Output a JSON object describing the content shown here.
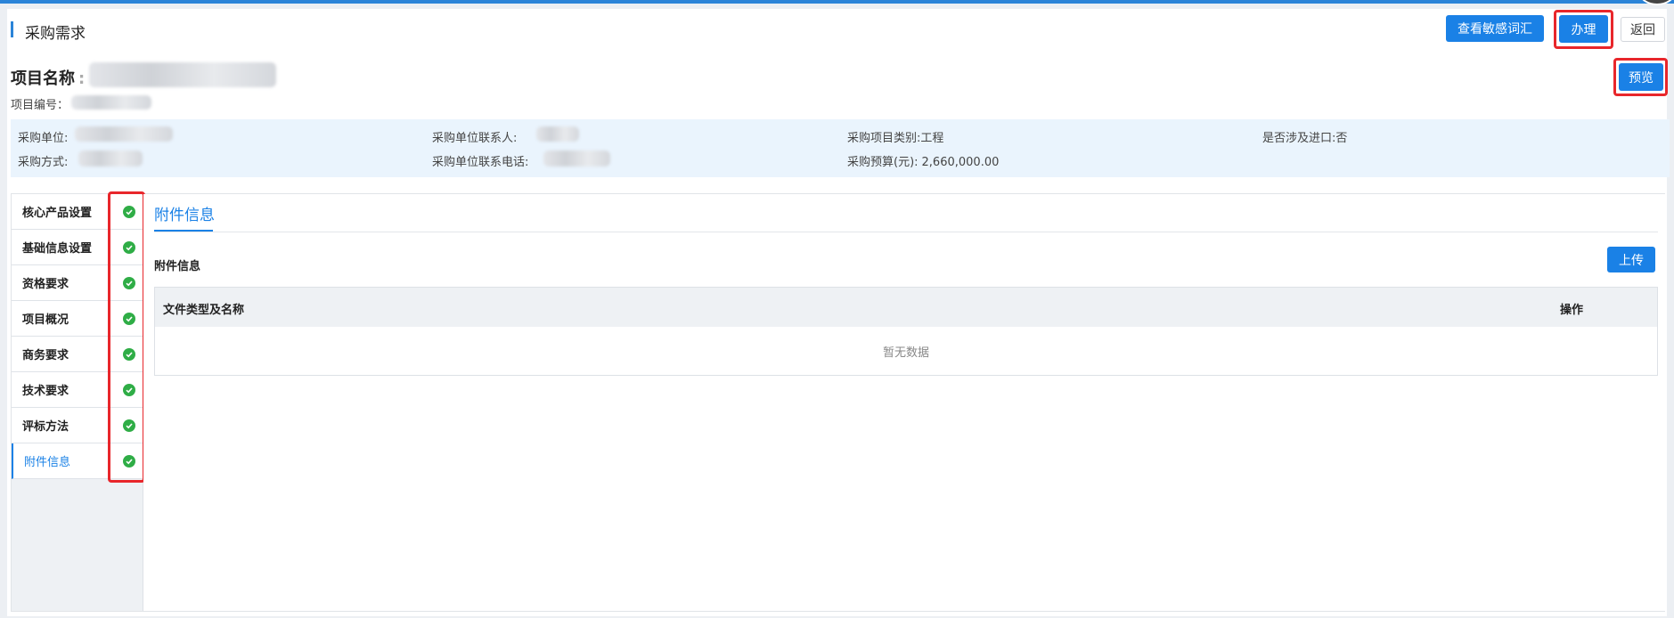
{
  "header": {
    "title": "采购需求",
    "view_sensitive_label": "查看敏感词汇",
    "handle_label": "办理",
    "back_label": "返回",
    "preview_label": "预览"
  },
  "project": {
    "name_label": "项目名称",
    "name_sep": ":",
    "number_label": "项目编号："
  },
  "info": {
    "unit_label": "采购单位:",
    "contact_label": "采购单位联系人:",
    "category_label": "采购项目类别:",
    "category_value": "工程",
    "import_label": "是否涉及进口:",
    "import_value": "否",
    "method_label": "采购方式:",
    "phone_label": "采购单位联系电话:",
    "budget_label": "采购预算(元):",
    "budget_value": "2,660,000.00"
  },
  "sidebar": {
    "items": [
      {
        "label": "核心产品设置"
      },
      {
        "label": "基础信息设置"
      },
      {
        "label": "资格要求"
      },
      {
        "label": "项目概况"
      },
      {
        "label": "商务要求"
      },
      {
        "label": "技术要求"
      },
      {
        "label": "评标方法"
      },
      {
        "label": "附件信息"
      }
    ],
    "active_index": 7,
    "check_icon": "check-circle-icon",
    "check_color": "#2fad46"
  },
  "main": {
    "tab_label": "附件信息",
    "section_title": "附件信息",
    "upload_label": "上传",
    "table": {
      "col_file": "文件类型及名称",
      "col_action": "操作",
      "empty_text": "暂无数据"
    }
  },
  "colors": {
    "primary": "#1a81e6",
    "highlight": "#e8262b",
    "info_bg": "#eaf4fd"
  }
}
